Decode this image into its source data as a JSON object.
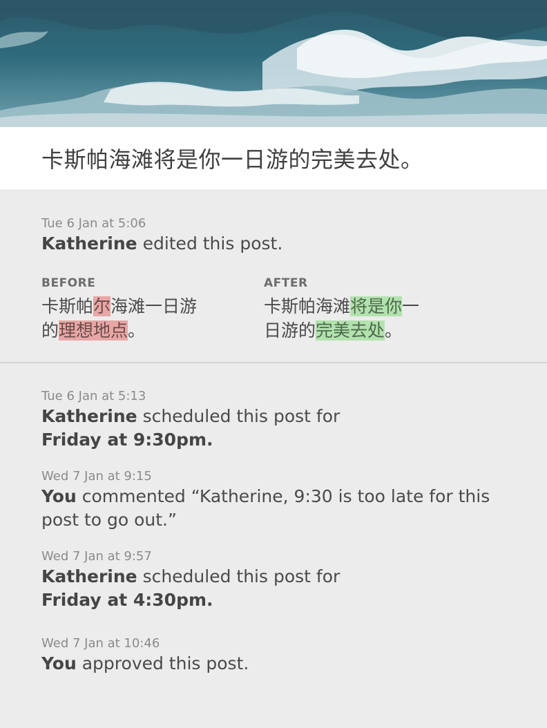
{
  "hero": {
    "image_label": "ocean-waves-photo"
  },
  "post_title": "卡斯帕海滩将是你一日游的完美去处。",
  "activity": [
    {
      "timestamp": "Tue 6 Jan at 5:06",
      "actor": "Katherine",
      "action": "edited this post.",
      "diff": {
        "before_label": "BEFORE",
        "after_label": "AFTER",
        "before": [
          {
            "text": "卡斯帕",
            "type": "same"
          },
          {
            "text": "尔",
            "type": "del"
          },
          {
            "text": "海滩一日游的",
            "type": "same"
          },
          {
            "text": "理想地点",
            "type": "del"
          },
          {
            "text": "。",
            "type": "same"
          }
        ],
        "after": [
          {
            "text": "卡斯帕海滩",
            "type": "same"
          },
          {
            "text": "将是你",
            "type": "ins"
          },
          {
            "text": "一日游的",
            "type": "same"
          },
          {
            "text": "完美去处",
            "type": "ins"
          },
          {
            "text": "。",
            "type": "same"
          }
        ]
      }
    },
    {
      "timestamp": "Tue 6 Jan at 5:13",
      "actor": "Katherine",
      "action": "scheduled this post for",
      "detail": "Friday at 9:30pm."
    },
    {
      "timestamp": "Wed 7 Jan at 9:15",
      "actor": "You",
      "action": "commented “Katherine, 9:30 is too late for this post to go out.”"
    },
    {
      "timestamp": "Wed 7 Jan at 9:57",
      "actor": "Katherine",
      "action": "scheduled this post for",
      "detail": "Friday at 4:30pm."
    },
    {
      "timestamp": "Wed 7 Jan at 10:46",
      "actor": "You",
      "action": "approved this post."
    }
  ]
}
